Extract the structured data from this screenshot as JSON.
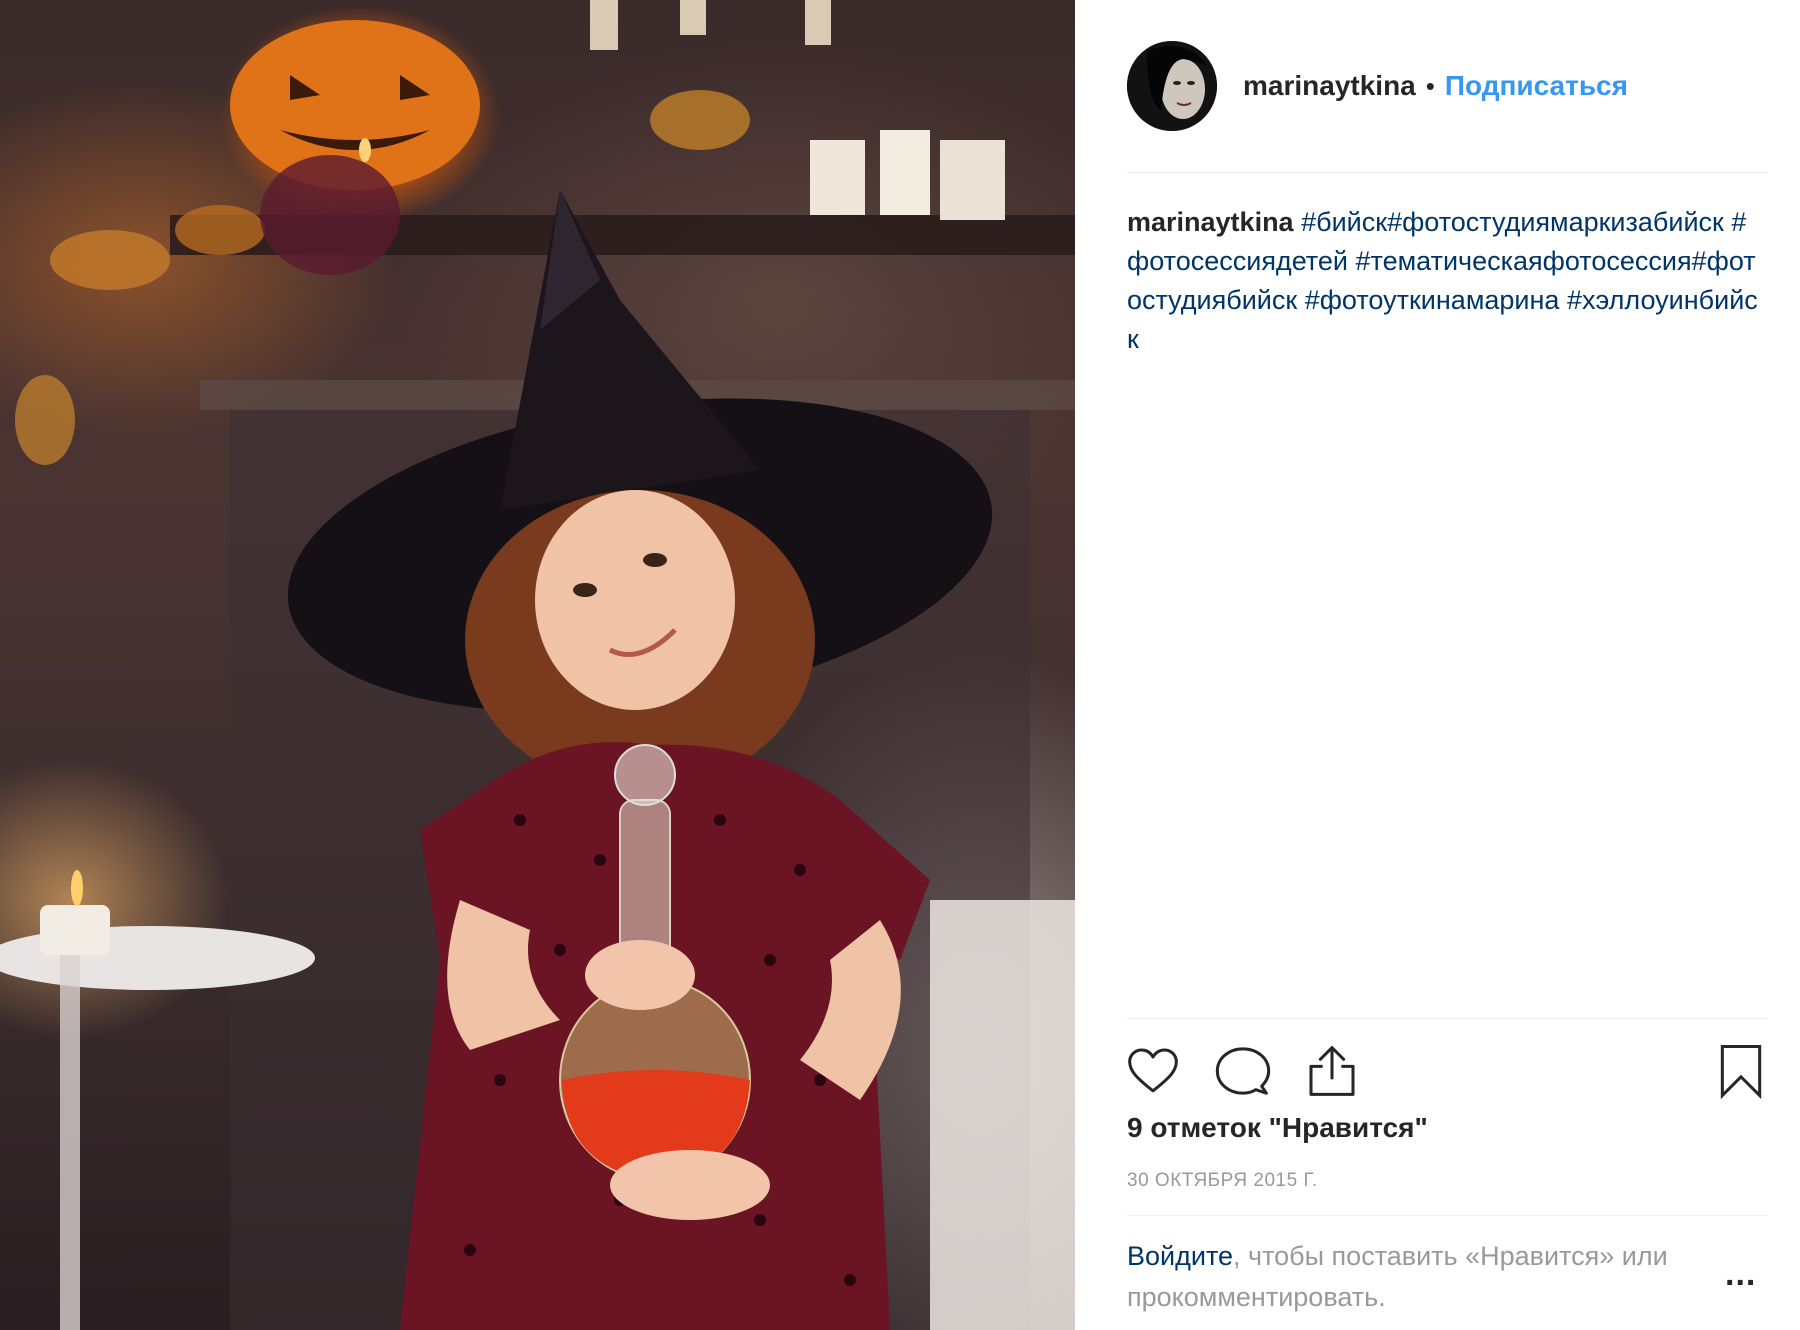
{
  "post": {
    "photo_description_icon": "photo"
  },
  "header": {
    "username": "marinaytkina",
    "separator": "•",
    "follow_label": "Подписаться"
  },
  "caption": {
    "username": "marinaytkina",
    "hashtags": [
      "#бийск",
      "#фотостудиямаркизабийск",
      "#фотосессиядетей",
      "#тематическаяфотосессия",
      "#фотостудиябийск",
      "#фотоуткинамарина",
      "#хэллоуинбийск"
    ]
  },
  "actions": {
    "like_icon": "heart-icon",
    "comment_icon": "comment-icon",
    "share_icon": "share-icon",
    "save_icon": "bookmark-icon"
  },
  "likes_text": "9 отметок \"Нравится\"",
  "date_text": "30 ОКТЯБРЯ 2015 Г.",
  "login_prompt": {
    "link_label": "Войдите",
    "rest": ", чтобы поставить «Нравится» или прокомментировать."
  },
  "more_label": "..."
}
